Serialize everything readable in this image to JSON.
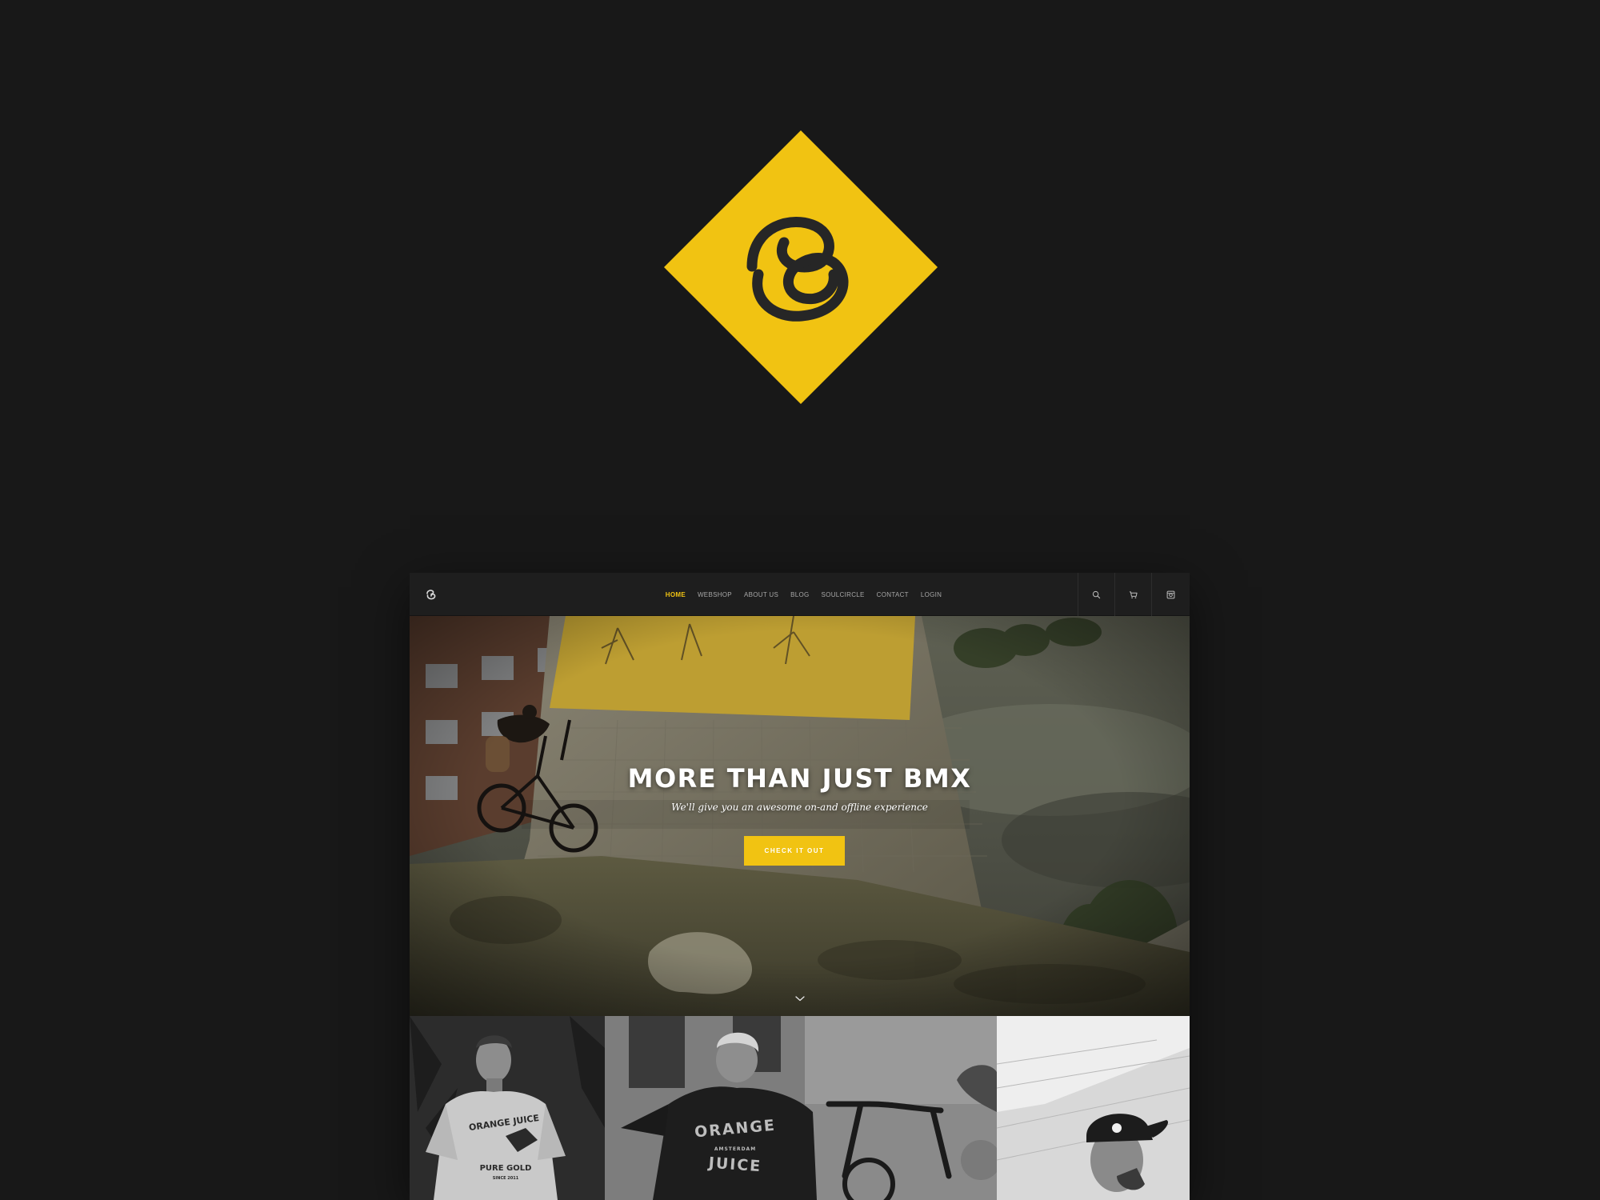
{
  "brand": {
    "accent": "#f1c312",
    "background": "#181818",
    "logo_icon": "soulcircle-logo-icon"
  },
  "nav": {
    "items": [
      {
        "label": "HOME",
        "active": true
      },
      {
        "label": "WEBSHOP",
        "active": false
      },
      {
        "label": "ABOUT US",
        "active": false
      },
      {
        "label": "BLOG",
        "active": false
      },
      {
        "label": "SOULCIRCLE",
        "active": false
      },
      {
        "label": "CONTACT",
        "active": false
      },
      {
        "label": "LOGIN",
        "active": false
      }
    ],
    "icons": [
      "search-icon",
      "cart-icon",
      "instagram-icon"
    ]
  },
  "hero": {
    "title": "MORE THAN JUST BMX",
    "subtitle": "We'll give you an awesome on-and offline experience",
    "cta_label": "CHECK IT OUT",
    "scroll_icon": "chevron-down-icon"
  },
  "gallery": {
    "tile1": {
      "shirt_top": "ORANGE JUICE",
      "shirt_bottom": "PURE GOLD",
      "shirt_since": "SINCE 2011"
    },
    "tile2": {
      "jacket_top": "ORANGE",
      "jacket_mid": "AMSTERDAM",
      "jacket_bottom": "JUICE"
    }
  }
}
